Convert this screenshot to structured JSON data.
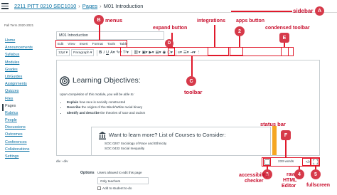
{
  "breadcrumb": {
    "course": "2211 PITT 0210 SEC1010",
    "section": "Pages",
    "page": "M01 Introduction"
  },
  "sidebar": {
    "term": "Fall Term 2020-2021",
    "items": [
      {
        "label": "Home"
      },
      {
        "label": "Announcements"
      },
      {
        "label": "Syllabus"
      },
      {
        "label": "Modules"
      },
      {
        "label": "Grades"
      },
      {
        "label": "LibGuides"
      },
      {
        "label": "Assignments"
      },
      {
        "label": "Quizzes"
      },
      {
        "label": "Files"
      },
      {
        "label": "Pages"
      },
      {
        "label": "Rubrics"
      },
      {
        "label": "People"
      },
      {
        "label": "Discussions"
      },
      {
        "label": "Outcomes"
      },
      {
        "label": "Conferences"
      },
      {
        "label": "Collaborations"
      },
      {
        "label": "Settings"
      }
    ]
  },
  "editor": {
    "title_value": "M01 Introduction",
    "menus": [
      "Edit",
      "View",
      "Insert",
      "Format",
      "Tools",
      "Table"
    ],
    "font_size": "12pt",
    "block_format": "Paragraph",
    "heading": "Learning Objectives:",
    "intro": "Upon completion of this module, you will be able to:",
    "bullets": [
      {
        "bold": "Explain",
        "rest": " how race is socially constructed"
      },
      {
        "bold": "Describe",
        "rest": " the origins of the Black/White racial binary"
      },
      {
        "bold": "Identify and describe",
        "rest": " the theories of race and racism"
      }
    ],
    "box_title": "Want to learn more? List of Courses to Consider:",
    "box_items": [
      "SOC 0207 Sociology of Race and Ethnicity",
      "SOC 0433 Social Inequality"
    ]
  },
  "statusbar": {
    "path": "div › div",
    "word_count": "233 words",
    "html_label": "</>"
  },
  "options": {
    "label": "Options",
    "users_text": "Users allowed to edit this page",
    "select_value": "Only teachers",
    "checkbox_label": "Add to student to-do"
  },
  "annotations": {
    "sidebar": "sidebar",
    "menus": "menus",
    "expand_button": "expand button",
    "integrations": "integrations",
    "apps_button": "apps button",
    "condensed_toolbar": "condensed toolbar",
    "toolbar": "toolbar",
    "status_bar": "status bar",
    "accessibility": [
      "accessibility",
      "checker"
    ],
    "raw_html": [
      "raw",
      "HTML",
      "Editor"
    ],
    "fullscreen": "fullscreen",
    "badges": {
      "A": "A",
      "B": "B",
      "C": "C",
      "D": "D",
      "E": "E",
      "F": "F",
      "one": "1",
      "two": "2",
      "three": "3",
      "four": "4",
      "five": "5"
    }
  },
  "colors": {
    "annotation": "#e0192b",
    "link": "#0770a3",
    "accent": "#f5a623"
  }
}
